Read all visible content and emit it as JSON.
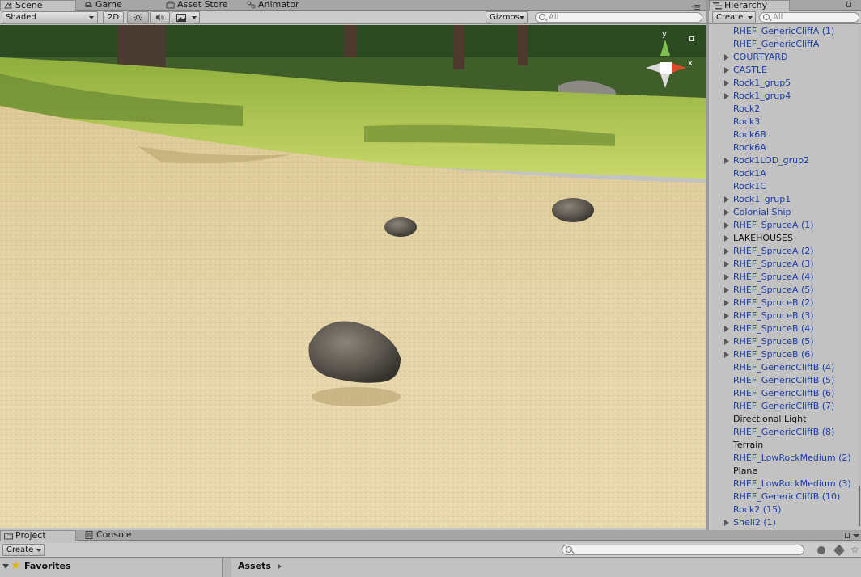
{
  "scene_tabs": [
    {
      "label": "Scene",
      "icon": "scene-icon",
      "active": true
    },
    {
      "label": "Game",
      "icon": "game-icon"
    },
    {
      "label": "Asset Store",
      "icon": "asset-store-icon"
    },
    {
      "label": "Animator",
      "icon": "animator-icon"
    }
  ],
  "scene_toolbar": {
    "shading_mode": "Shaded",
    "mode_2d": "2D",
    "gizmos": "Gizmos",
    "search_placeholder": "All"
  },
  "gizmo_axes": {
    "y": "y",
    "x": "x"
  },
  "hierarchy": {
    "tab_label": "Hierarchy",
    "create_label": "Create",
    "search_placeholder": "All",
    "items": [
      {
        "label": "RHEF_GenericCliffA (1)",
        "prefab": true,
        "expandable": false
      },
      {
        "label": "RHEF_GenericCliffA",
        "prefab": true,
        "expandable": false
      },
      {
        "label": "COURTYARD",
        "prefab": true,
        "expandable": true
      },
      {
        "label": "CASTLE",
        "prefab": true,
        "expandable": true
      },
      {
        "label": "Rock1_grup5",
        "prefab": true,
        "expandable": true
      },
      {
        "label": "Rock1_grup4",
        "prefab": true,
        "expandable": true
      },
      {
        "label": "Rock2",
        "prefab": true,
        "expandable": false
      },
      {
        "label": "Rock3",
        "prefab": true,
        "expandable": false
      },
      {
        "label": "Rock6B",
        "prefab": true,
        "expandable": false
      },
      {
        "label": "Rock6A",
        "prefab": true,
        "expandable": false
      },
      {
        "label": "Rock1LOD_grup2",
        "prefab": true,
        "expandable": true
      },
      {
        "label": "Rock1A",
        "prefab": true,
        "expandable": false
      },
      {
        "label": "Rock1C",
        "prefab": true,
        "expandable": false
      },
      {
        "label": "Rock1_grup1",
        "prefab": true,
        "expandable": true
      },
      {
        "label": "Colonial Ship",
        "prefab": true,
        "expandable": true
      },
      {
        "label": "RHEF_SpruceA (1)",
        "prefab": true,
        "expandable": true
      },
      {
        "label": "LAKEHOUSES",
        "prefab": false,
        "expandable": true
      },
      {
        "label": "RHEF_SpruceA (2)",
        "prefab": true,
        "expandable": true
      },
      {
        "label": "RHEF_SpruceA (3)",
        "prefab": true,
        "expandable": true
      },
      {
        "label": "RHEF_SpruceA (4)",
        "prefab": true,
        "expandable": true
      },
      {
        "label": "RHEF_SpruceA (5)",
        "prefab": true,
        "expandable": true
      },
      {
        "label": "RHEF_SpruceB (2)",
        "prefab": true,
        "expandable": true
      },
      {
        "label": "RHEF_SpruceB (3)",
        "prefab": true,
        "expandable": true
      },
      {
        "label": "RHEF_SpruceB (4)",
        "prefab": true,
        "expandable": true
      },
      {
        "label": "RHEF_SpruceB (5)",
        "prefab": true,
        "expandable": true
      },
      {
        "label": "RHEF_SpruceB (6)",
        "prefab": true,
        "expandable": true
      },
      {
        "label": "RHEF_GenericCliffB (4)",
        "prefab": true,
        "expandable": false
      },
      {
        "label": "RHEF_GenericCliffB (5)",
        "prefab": true,
        "expandable": false
      },
      {
        "label": "RHEF_GenericCliffB (6)",
        "prefab": true,
        "expandable": false
      },
      {
        "label": "RHEF_GenericCliffB (7)",
        "prefab": true,
        "expandable": false
      },
      {
        "label": "Directional Light",
        "prefab": false,
        "expandable": false
      },
      {
        "label": "RHEF_GenericCliffB (8)",
        "prefab": true,
        "expandable": false
      },
      {
        "label": "Terrain",
        "prefab": false,
        "expandable": false
      },
      {
        "label": "RHEF_LowRockMedium (2)",
        "prefab": true,
        "expandable": false
      },
      {
        "label": "Plane",
        "prefab": false,
        "expandable": false
      },
      {
        "label": "RHEF_LowRockMedium (3)",
        "prefab": true,
        "expandable": false
      },
      {
        "label": "RHEF_GenericCliffB (10)",
        "prefab": true,
        "expandable": false
      },
      {
        "label": "Rock2 (15)",
        "prefab": true,
        "expandable": false
      },
      {
        "label": "Shell2 (1)",
        "prefab": true,
        "expandable": true
      }
    ]
  },
  "bottom": {
    "tabs": [
      {
        "label": "Project",
        "icon": "folder-icon",
        "active": true
      },
      {
        "label": "Console",
        "icon": "console-icon"
      }
    ],
    "create_label": "Create",
    "favorites_label": "Favorites",
    "assets_label": "Assets"
  },
  "colors": {
    "prefab_text": "#1d3ea6",
    "panel_bg": "#c2c2c2",
    "tab_bar": "#a6a6a6"
  }
}
